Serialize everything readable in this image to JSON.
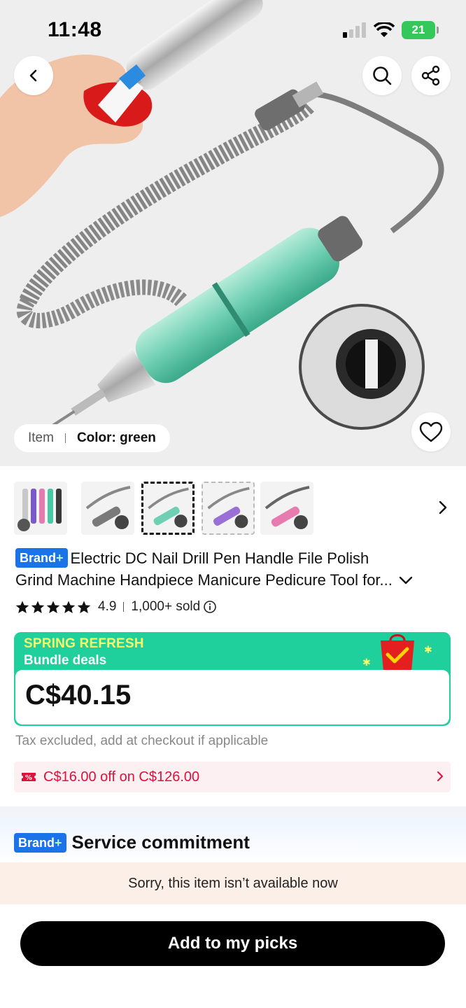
{
  "status_bar": {
    "time": "11:48",
    "battery": "21"
  },
  "hero": {
    "variant_label": "Item",
    "variant_value": "Color: green"
  },
  "thumbnails": [
    {
      "name": "multi-color",
      "selected": false
    },
    {
      "name": "gray",
      "selected": false
    },
    {
      "name": "green",
      "selected": true
    },
    {
      "name": "purple",
      "selected": false
    },
    {
      "name": "pink",
      "selected": false
    }
  ],
  "product": {
    "brand_badge": "Brand",
    "brand_plus": "+",
    "title_line1": "Electric DC Nail Drill Pen Handle File Polish",
    "title_line2": "Grind Machine Handpiece Manicure Pedicure Tool for...",
    "rating": "4.9",
    "sold": "1,000+ sold",
    "stars": 5
  },
  "promo": {
    "title": "SPRING REFRESH",
    "subtitle": "Bundle deals",
    "price": "C$40.15"
  },
  "tax_note": "Tax excluded, add at checkout if applicable",
  "coupon": {
    "text": "C$16.00 off on C$126.00"
  },
  "service": {
    "badge": "Brand",
    "badge_plus": "+",
    "title": "Service commitment"
  },
  "unavailable_text": "Sorry, this item isn’t available now",
  "cta_label": "Add to my picks",
  "icons": [
    "back-icon",
    "search-icon",
    "share-icon",
    "heart-icon",
    "chevron-right-icon",
    "chevron-down-icon",
    "star-icon",
    "info-icon",
    "coupon-icon",
    "signal-icon",
    "wifi-icon",
    "battery-icon"
  ],
  "colors": {
    "promo_green": "#1fcf9c",
    "promo_yellow": "#f4ff6a",
    "coupon_red": "#e0103a",
    "brand_blue": "#1a73e8",
    "cta_black": "#000000"
  }
}
